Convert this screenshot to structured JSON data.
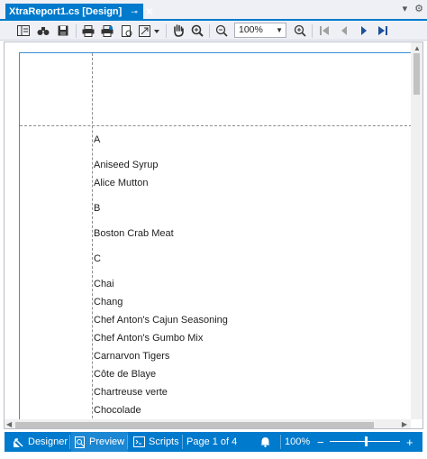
{
  "tab": {
    "title": "XtraReport1.cs [Design]",
    "pin_icon": "pin-icon",
    "close_icon": "close-icon"
  },
  "window": {
    "dropdown_icon": "chevron-down-icon",
    "settings_icon": "gear-icon"
  },
  "toolbar": {
    "zoom_value": "100%",
    "icons": [
      "document-map-icon",
      "find-icon",
      "save-icon",
      "print-icon",
      "quick-print-icon",
      "page-setup-icon",
      "scale-icon",
      "hand-tool-icon",
      "magnifier-icon",
      "zoom-out-icon",
      "zoom-in-icon",
      "first-page-icon",
      "previous-page-icon",
      "next-page-icon",
      "last-page-icon"
    ]
  },
  "report": {
    "rows": [
      "A",
      "Aniseed Syrup",
      "Alice Mutton",
      "B",
      "Boston Crab Meat",
      "C",
      "Chai",
      "Chang",
      "Chef Anton's Cajun Seasoning",
      "Chef Anton's Gumbo Mix",
      "Carnarvon Tigers",
      "Côte de Blaye",
      "Chartreuse verte",
      "Chocolade"
    ]
  },
  "statusbar": {
    "designer_label": "Designer",
    "preview_label": "Preview",
    "scripts_label": "Scripts",
    "page_info": "Page 1 of 4",
    "zoom_label": "100%",
    "colors": {
      "bar": "#007acc",
      "accent": "#3b8fd6"
    }
  }
}
